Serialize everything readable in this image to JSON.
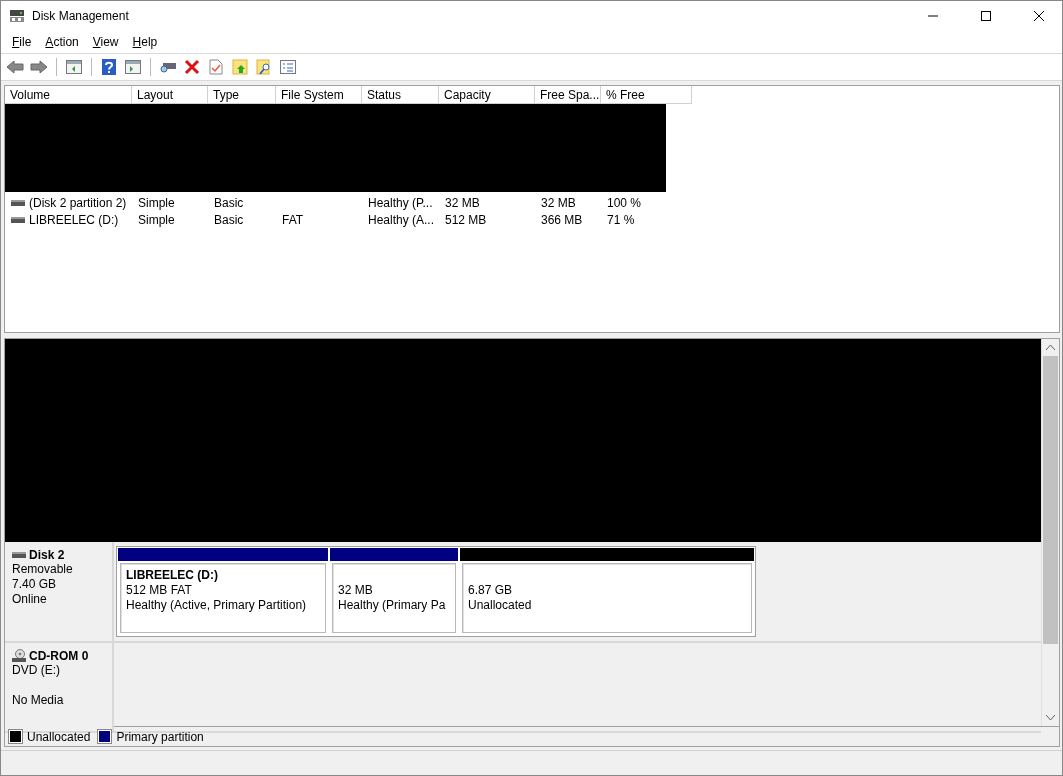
{
  "window": {
    "title": "Disk Management"
  },
  "menu": [
    "File",
    "Action",
    "View",
    "Help"
  ],
  "volume_list": {
    "columns": [
      "Volume",
      "Layout",
      "Type",
      "File System",
      "Status",
      "Capacity",
      "Free Spa...",
      "% Free"
    ],
    "rows": [
      {
        "cells": [
          "(Disk 2 partition 2)",
          "Simple",
          "Basic",
          "",
          "Healthy (P...",
          "32 MB",
          "32 MB",
          "100 %"
        ]
      },
      {
        "cells": [
          "LIBREELEC (D:)",
          "Simple",
          "Basic",
          "FAT",
          "Healthy (A...",
          "512 MB",
          "366 MB",
          "71 %"
        ]
      }
    ]
  },
  "disks": [
    {
      "kind": "disk",
      "name": "Disk 2",
      "lines": [
        "Removable",
        "7.40 GB",
        "Online"
      ],
      "partitions": [
        {
          "title": "LIBREELEC  (D:)",
          "lines": [
            "512 MB FAT",
            "Healthy (Active, Primary Partition)"
          ],
          "color": "#000080"
        },
        {
          "lines": [
            "32 MB",
            "Healthy (Primary Pa"
          ],
          "color": "#000080"
        },
        {
          "lines": [
            "6.87 GB",
            "Unallocated"
          ],
          "color": "#000000"
        }
      ]
    },
    {
      "kind": "cdrom",
      "name": "CD-ROM 0",
      "lines": [
        "DVD (E:)",
        "No Media"
      ]
    }
  ],
  "legend": [
    {
      "label": "Unallocated",
      "color": "#000000"
    },
    {
      "label": "Primary partition",
      "color": "#000080"
    }
  ]
}
